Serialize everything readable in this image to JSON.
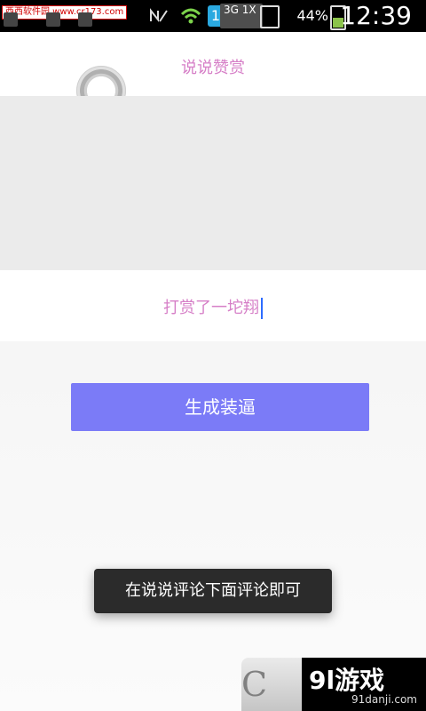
{
  "statusbar": {
    "watermark": "西西软件园 www.cr173.com",
    "network": "3G\n1X",
    "sim_slot": "1",
    "battery_percent": "44%",
    "time": "12:39",
    "icons": [
      "nfc-icon",
      "wifi-icon",
      "sim-icon",
      "network-3g-icon",
      "sd-card-icon",
      "battery-icon"
    ]
  },
  "header": {
    "title": "说说赞赏",
    "spinner_icon": "loading-spinner-icon"
  },
  "input": {
    "value": "打赏了一坨翔"
  },
  "actions": {
    "generate_label": "生成装逼"
  },
  "toast": {
    "message": "在说说评论下面评论即可"
  },
  "watermarks": {
    "left": "C",
    "right_main": "9l游戏",
    "right_sub": "91danji.com"
  },
  "colors": {
    "accent_pink": "#d67fc7",
    "button_blue": "#7b7bf7",
    "caret_blue": "#2d6cff",
    "toast_bg": "#2b2b2b",
    "statusbar_bg": "#000000"
  }
}
